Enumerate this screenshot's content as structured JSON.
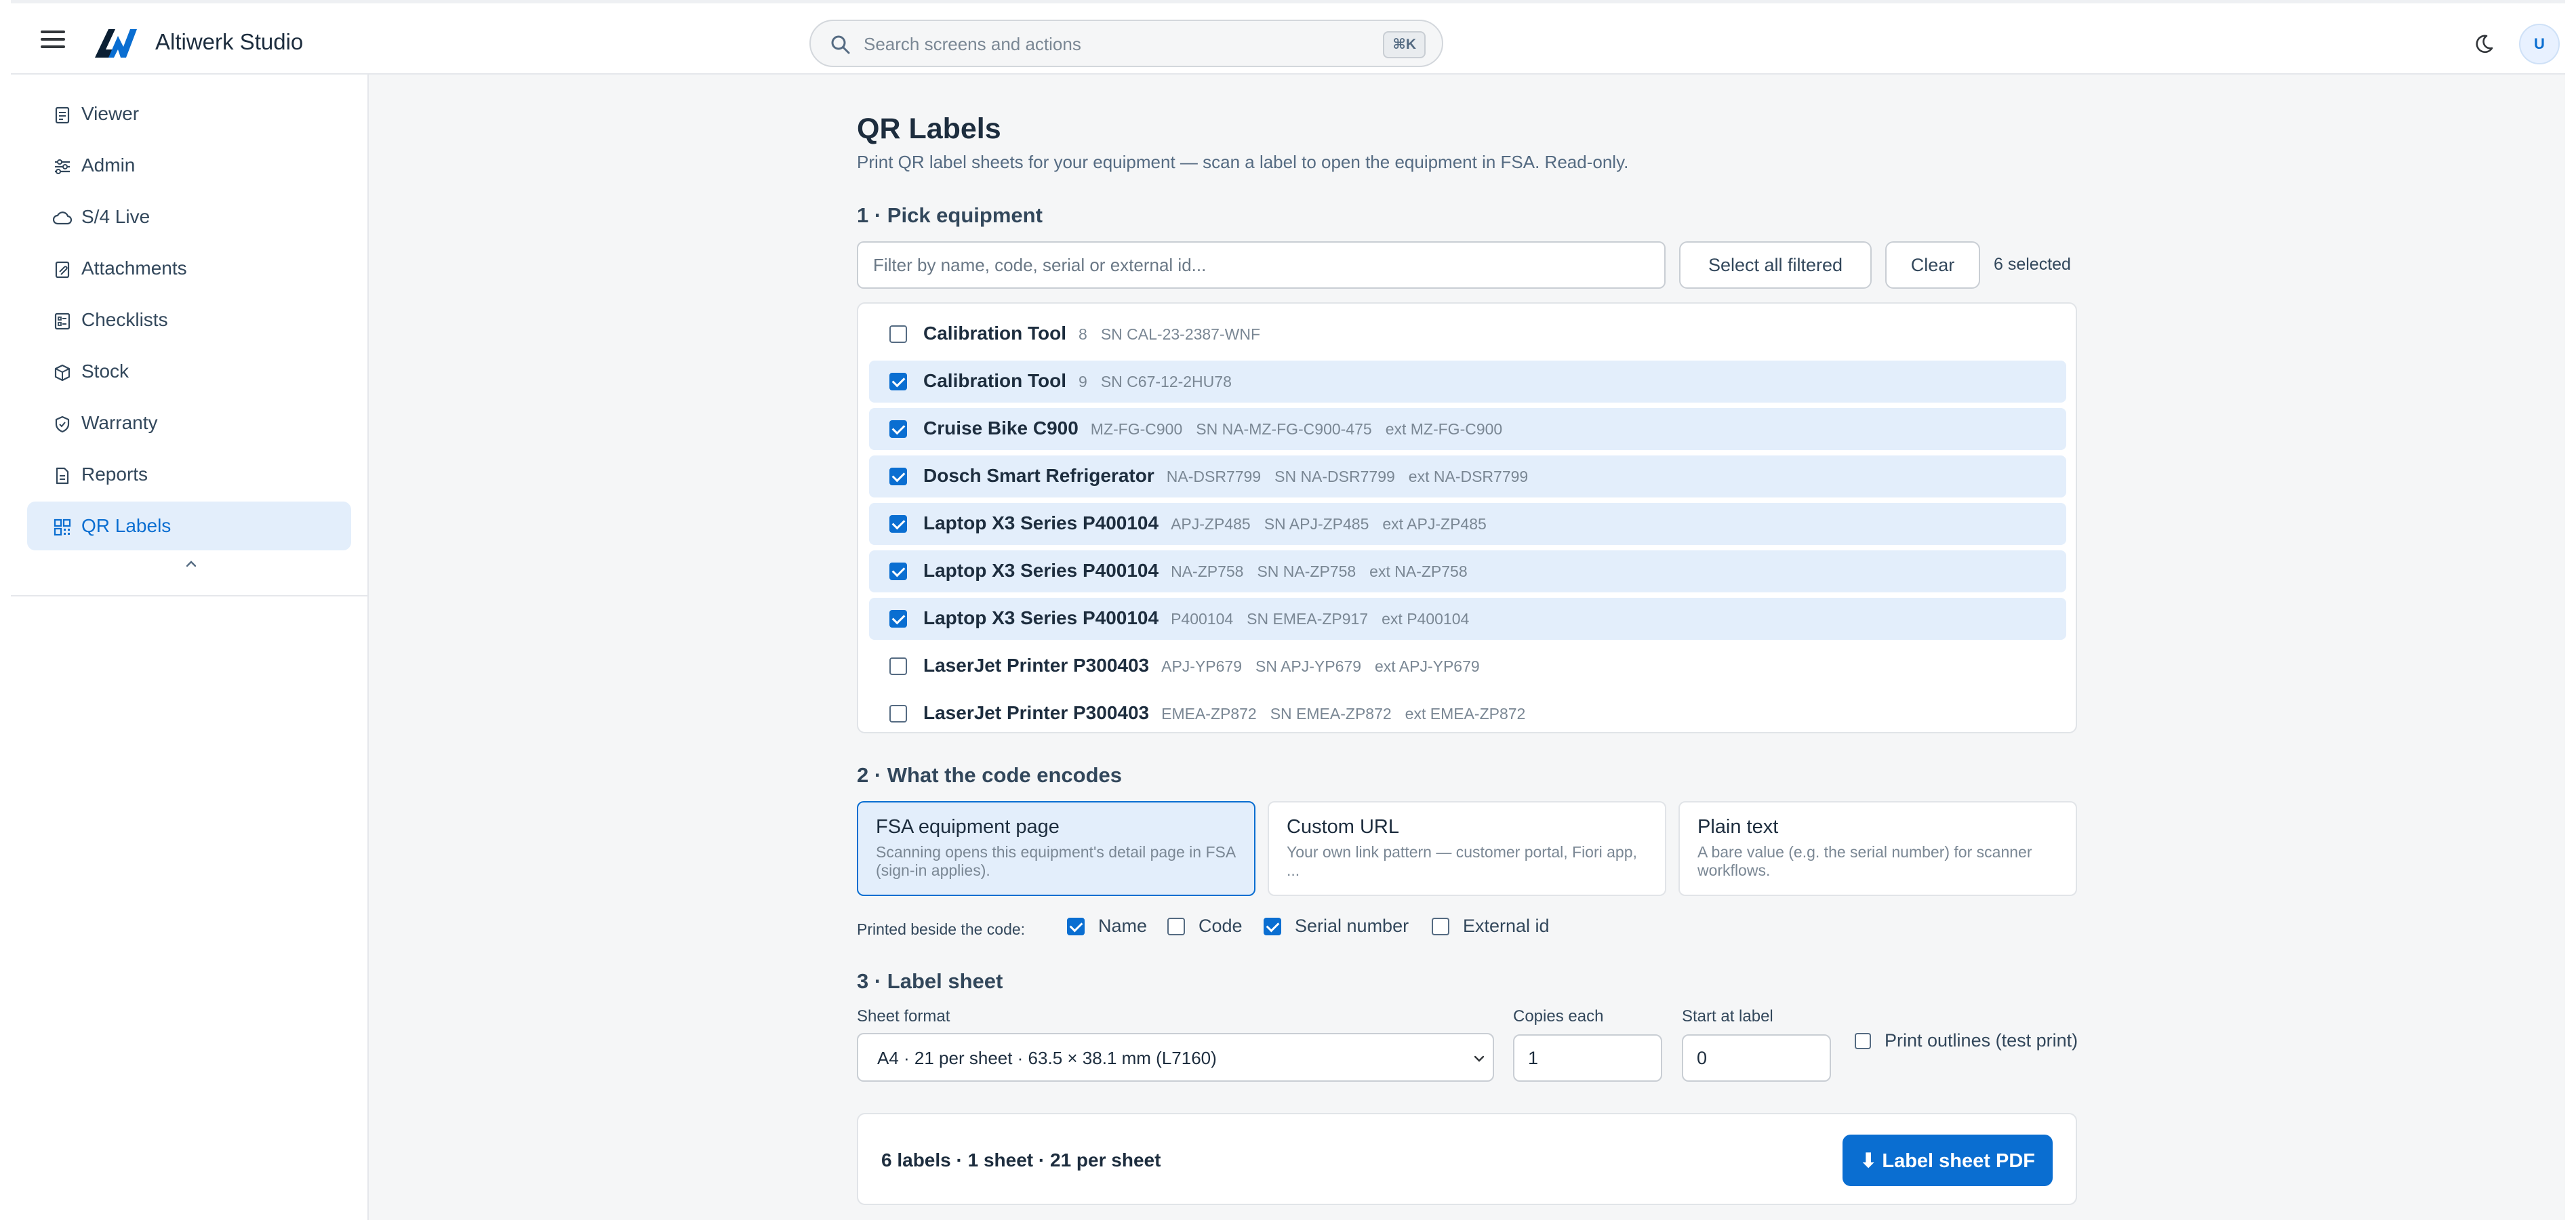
{
  "app": {
    "name": "Altiwerk Studio",
    "avatar_initial": "U"
  },
  "search": {
    "placeholder": "Search screens and actions",
    "shortcut": "⌘K"
  },
  "sidebar": {
    "items": [
      {
        "label": "Viewer",
        "icon": "document-icon"
      },
      {
        "label": "Admin",
        "icon": "sliders-icon"
      },
      {
        "label": "S/4 Live",
        "icon": "cloud-icon"
      },
      {
        "label": "Attachments",
        "icon": "attachment-icon"
      },
      {
        "label": "Checklists",
        "icon": "checklist-icon"
      },
      {
        "label": "Stock",
        "icon": "box-icon"
      },
      {
        "label": "Warranty",
        "icon": "shield-check-icon"
      },
      {
        "label": "Reports",
        "icon": "report-icon"
      },
      {
        "label": "QR Labels",
        "icon": "qr-icon",
        "active": true
      }
    ]
  },
  "page": {
    "title": "QR Labels",
    "subtitle": "Print QR label sheets for your equipment — scan a label to open the equipment in FSA. Read-only."
  },
  "pick": {
    "heading": "1 · Pick equipment",
    "filter_placeholder": "Filter by name, code, serial or external id...",
    "select_all_label": "Select all filtered",
    "clear_label": "Clear",
    "selected_count": "6 selected",
    "rows": [
      {
        "name": "Calibration Tool",
        "meta": [
          "8",
          "SN CAL-23-2387-WNF"
        ],
        "checked": false
      },
      {
        "name": "Calibration Tool",
        "meta": [
          "9",
          "SN C67-12-2HU78"
        ],
        "checked": true
      },
      {
        "name": "Cruise Bike C900",
        "meta": [
          "MZ-FG-C900",
          "SN NA-MZ-FG-C900-475",
          "ext MZ-FG-C900"
        ],
        "checked": true
      },
      {
        "name": "Dosch Smart Refrigerator",
        "meta": [
          "NA-DSR7799",
          "SN NA-DSR7799",
          "ext NA-DSR7799"
        ],
        "checked": true
      },
      {
        "name": "Laptop X3 Series P400104",
        "meta": [
          "APJ-ZP485",
          "SN APJ-ZP485",
          "ext APJ-ZP485"
        ],
        "checked": true
      },
      {
        "name": "Laptop X3 Series P400104",
        "meta": [
          "NA-ZP758",
          "SN NA-ZP758",
          "ext NA-ZP758"
        ],
        "checked": true
      },
      {
        "name": "Laptop X3 Series P400104",
        "meta": [
          "P400104",
          "SN EMEA-ZP917",
          "ext P400104"
        ],
        "checked": true
      },
      {
        "name": "LaserJet Printer P300403",
        "meta": [
          "APJ-YP679",
          "SN APJ-YP679",
          "ext APJ-YP679"
        ],
        "checked": false
      },
      {
        "name": "LaserJet Printer P300403",
        "meta": [
          "EMEA-ZP872",
          "SN EMEA-ZP872",
          "ext EMEA-ZP872"
        ],
        "checked": false
      }
    ]
  },
  "encode": {
    "heading": "2 · What the code encodes",
    "options": [
      {
        "title": "FSA equipment page",
        "desc": "Scanning opens this equipment's detail page in FSA (sign-in applies).",
        "selected": true
      },
      {
        "title": "Custom URL",
        "desc": "Your own link pattern — customer portal, Fiori app, ...",
        "selected": false
      },
      {
        "title": "Plain text",
        "desc": "A bare value (e.g. the serial number) for scanner workflows.",
        "selected": false
      }
    ],
    "printed_label": "Printed beside the code:",
    "printed_fields": [
      {
        "label": "Name",
        "checked": true
      },
      {
        "label": "Code",
        "checked": false
      },
      {
        "label": "Serial number",
        "checked": true
      },
      {
        "label": "External id",
        "checked": false
      }
    ]
  },
  "sheet": {
    "heading": "3 · Label sheet",
    "format_label": "Sheet format",
    "format_value": "A4 · 21 per sheet · 63.5 × 38.1 mm (L7160)",
    "copies_label": "Copies each",
    "copies_value": "1",
    "start_label": "Start at label",
    "start_value": "0",
    "outlines_label": "Print outlines (test print)",
    "outlines_checked": false
  },
  "summary": {
    "text": "6 labels · 1 sheet · 21 per sheet",
    "pdf_button": "⬇ Label sheet PDF"
  },
  "colors": {
    "accent": "#0a6ed1",
    "selected_bg": "#e3eefb",
    "page_bg": "#f5f6f7"
  }
}
